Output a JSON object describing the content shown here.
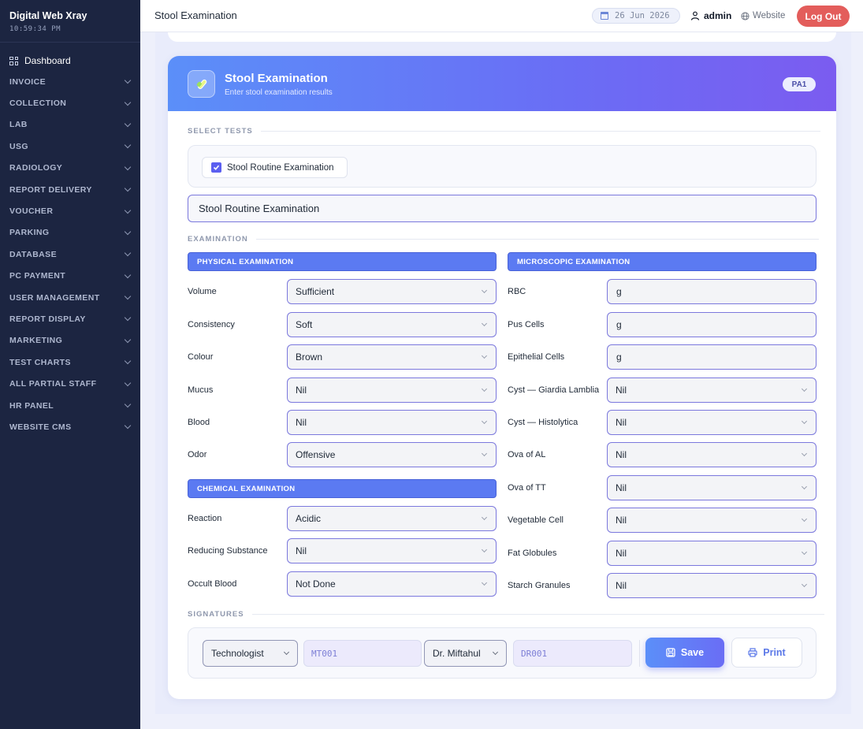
{
  "sidebar": {
    "brand": "Digital Web Xray",
    "time": "10:59:34 PM",
    "dashboard": "Dashboard",
    "items": [
      {
        "label": "INVOICE"
      },
      {
        "label": "COLLECTION"
      },
      {
        "label": "LAB"
      },
      {
        "label": "USG"
      },
      {
        "label": "RADIOLOGY"
      },
      {
        "label": "REPORT DELIVERY"
      },
      {
        "label": "VOUCHER"
      },
      {
        "label": "PARKING"
      },
      {
        "label": "DATABASE"
      },
      {
        "label": "PC PAYMENT"
      },
      {
        "label": "USER MANAGEMENT"
      },
      {
        "label": "REPORT DISPLAY"
      },
      {
        "label": "MARKETING"
      },
      {
        "label": "TEST CHARTS"
      },
      {
        "label": "ALL PARTIAL STAFF"
      },
      {
        "label": "HR PANEL"
      },
      {
        "label": "WEBSITE CMS"
      }
    ]
  },
  "topbar": {
    "title": "Stool Examination",
    "date": "26 Jun 2026",
    "user": "admin",
    "website": "Website",
    "logout": "Log Out"
  },
  "card": {
    "title": "Stool Examination",
    "subtitle": "Enter stool examination results",
    "badge": "PA1"
  },
  "select_tests": {
    "label": "SELECT TESTS",
    "checkbox_label": "Stool Routine Examination",
    "checked": true,
    "selected_text": "Stool Routine Examination"
  },
  "examination": {
    "label": "EXAMINATION",
    "physical": {
      "title": "PHYSICAL EXAMINATION",
      "fields": [
        {
          "label": "Volume",
          "value": "Sufficient"
        },
        {
          "label": "Consistency",
          "value": "Soft"
        },
        {
          "label": "Colour",
          "value": "Brown"
        },
        {
          "label": "Mucus",
          "value": "Nil"
        },
        {
          "label": "Blood",
          "value": "Nil"
        },
        {
          "label": "Odor",
          "value": "Offensive"
        }
      ]
    },
    "chemical": {
      "title": "CHEMICAL EXAMINATION",
      "fields": [
        {
          "label": "Reaction",
          "value": "Acidic"
        },
        {
          "label": "Reducing Substance",
          "value": "Nil"
        },
        {
          "label": "Occult Blood",
          "value": "Not Done"
        }
      ]
    },
    "microscopic": {
      "title": "MICROSCOPIC EXAMINATION",
      "fields": [
        {
          "label": "RBC",
          "value": "g",
          "type": "input"
        },
        {
          "label": "Pus Cells",
          "value": "g",
          "type": "input"
        },
        {
          "label": "Epithelial Cells",
          "value": "g",
          "type": "input"
        },
        {
          "label": "Cyst — Giardia Lamblia",
          "value": "Nil",
          "type": "select"
        },
        {
          "label": "Cyst — Histolytica",
          "value": "Nil",
          "type": "select"
        },
        {
          "label": "Ova of AL",
          "value": "Nil",
          "type": "select"
        },
        {
          "label": "Ova of TT",
          "value": "Nil",
          "type": "select"
        },
        {
          "label": "Vegetable Cell",
          "value": "Nil",
          "type": "select"
        },
        {
          "label": "Fat Globules",
          "value": "Nil",
          "type": "select"
        },
        {
          "label": "Starch Granules",
          "value": "Nil",
          "type": "select"
        }
      ]
    }
  },
  "signatures": {
    "label": "SIGNATURES",
    "technologist": "Technologist",
    "technologist_code": "MT001",
    "doctor": "Dr. Miftahul",
    "doctor_code": "DR001",
    "save": "Save",
    "print": "Print"
  },
  "colors": {
    "sidebar_bg": "#1c2541",
    "accent": "#5b7af2",
    "logout": "#e35d5b"
  }
}
